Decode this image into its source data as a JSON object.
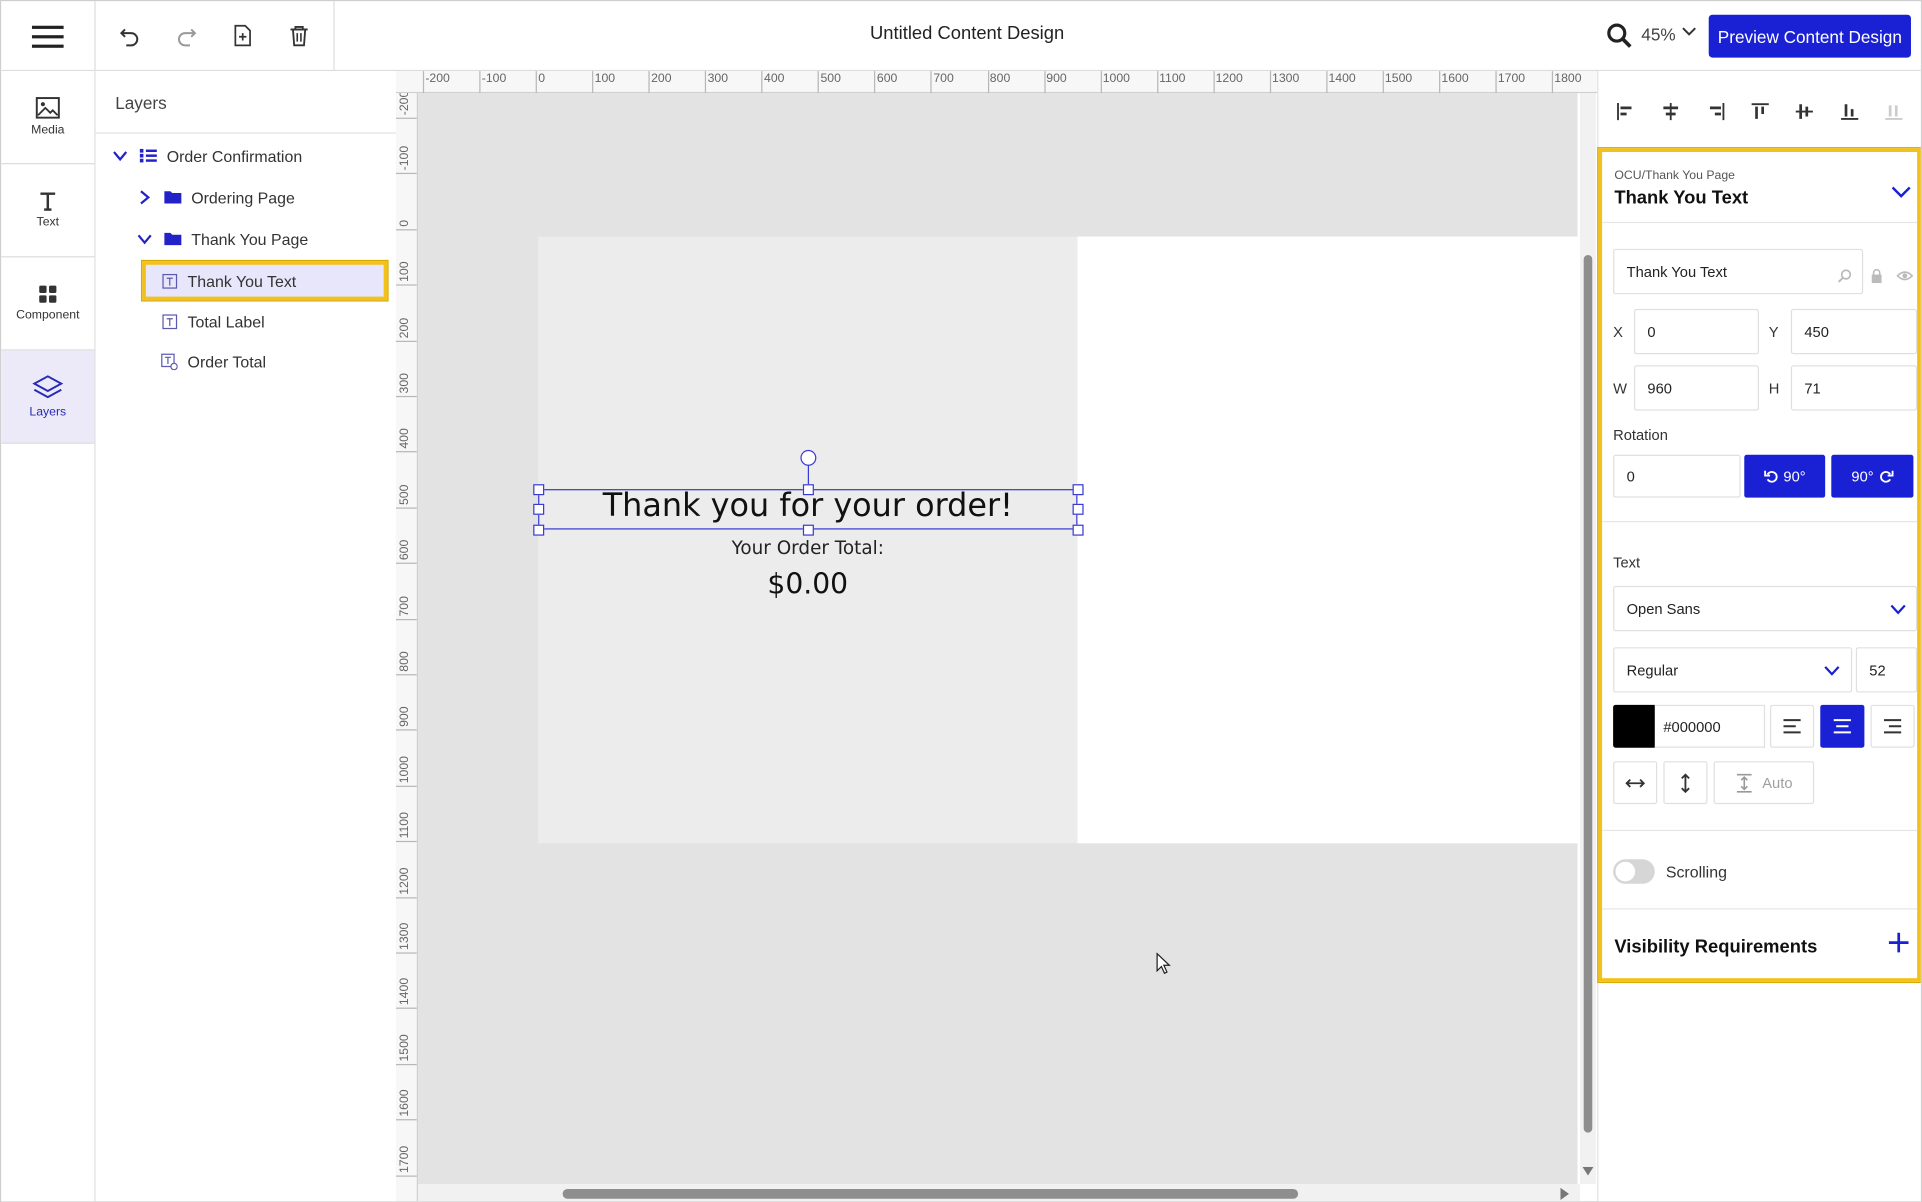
{
  "header": {
    "title": "Untitled Content Design",
    "zoom": "45%",
    "preview_label": "Preview Content Design",
    "tools": [
      "undo-icon",
      "redo-icon",
      "new-page-icon",
      "trash-icon"
    ]
  },
  "rail": {
    "items": [
      {
        "label": "Media",
        "icon": "image-icon"
      },
      {
        "label": "Text",
        "icon": "text-icon"
      },
      {
        "label": "Component",
        "icon": "grid-icon"
      },
      {
        "label": "Layers",
        "icon": "layers-icon",
        "active": true
      }
    ]
  },
  "layers": {
    "title": "Layers",
    "tree": [
      {
        "label": "Order Confirmation",
        "icon": "list-icon",
        "expanded": true
      },
      {
        "label": "Ordering Page",
        "icon": "folder-icon",
        "expanded": false
      },
      {
        "label": "Thank You Page",
        "icon": "folder-icon",
        "expanded": true
      },
      {
        "label": "Thank You Text",
        "icon": "text-box-icon",
        "selected": true
      },
      {
        "label": "Total Label",
        "icon": "text-box-icon"
      },
      {
        "label": "Order Total",
        "icon": "data-text-icon"
      }
    ]
  },
  "ruler": {
    "top": [
      "-200",
      "-100",
      "0",
      "100",
      "200",
      "300",
      "400",
      "500",
      "600",
      "700",
      "800",
      "900",
      "1000",
      "1100",
      "1200",
      "1300",
      "1400",
      "1500",
      "1600",
      "1700",
      "1800"
    ],
    "left": [
      "-200",
      "-100",
      "0",
      "100",
      "200",
      "300",
      "400",
      "500",
      "600",
      "700",
      "800",
      "900",
      "1000",
      "1100",
      "1200",
      "1300",
      "1400",
      "1500",
      "1600",
      "1700"
    ]
  },
  "canvas": {
    "thank_you": "Thank you for your order!",
    "total_label": "Your Order Total:",
    "total_value": "$0.00"
  },
  "inspector": {
    "breadcrumb": "OCU/Thank You Page",
    "title": "Thank You Text",
    "name_value": "Thank You Text",
    "x_label": "X",
    "x_value": "0",
    "y_label": "Y",
    "y_value": "450",
    "w_label": "W",
    "w_value": "960",
    "h_label": "H",
    "h_value": "71",
    "rotation_label": "Rotation",
    "rotation_value": "0",
    "rotate_left_label": "90°",
    "rotate_right_label": "90°",
    "text_label": "Text",
    "font_family": "Open Sans",
    "font_weight": "Regular",
    "font_size": "52",
    "color_hex": "#000000",
    "accent_color": "#1a20d4",
    "auto_label": "Auto",
    "scrolling_label": "Scrolling",
    "scrolling_on": false,
    "visibility_title": "Visibility Requirements"
  }
}
